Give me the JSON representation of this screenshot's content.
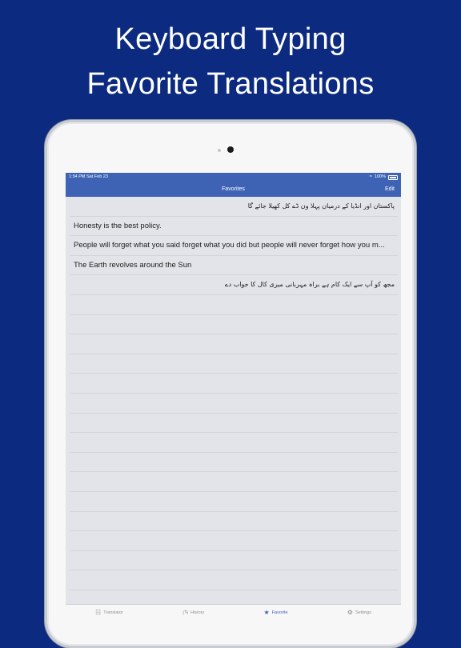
{
  "promo": {
    "line1": "Keyboard Typing",
    "line2": "Favorite Translations"
  },
  "status_bar": {
    "time": "1:54 PM",
    "date": "Sat Feb 23",
    "battery": "100%"
  },
  "nav": {
    "title": "Favorites",
    "edit_label": "Edit"
  },
  "favorites": [
    {
      "text": "پاکستان اور انڈیا کے درمیان پہلا ون ڈے کل کھیلا جائے گا",
      "lang": "ur"
    },
    {
      "text": "Honesty is the best policy.",
      "lang": "en"
    },
    {
      "text": "People will forget what you said forget what you did but people will never forget how you m...",
      "lang": "en"
    },
    {
      "text": "The Earth revolves around the Sun",
      "lang": "en"
    },
    {
      "text": "مجھ کو آپ سے ایک کام ہے براہ مہربانی میری کال کا جواب دے",
      "lang": "ur"
    }
  ],
  "empty_rows": 15,
  "tabs": [
    {
      "label": "Translator",
      "icon": "translate-icon",
      "active": false
    },
    {
      "label": "History",
      "icon": "clock-icon",
      "active": false
    },
    {
      "label": "Favorite",
      "icon": "star-icon",
      "active": true
    },
    {
      "label": "Settings",
      "icon": "gear-icon",
      "active": false
    }
  ],
  "colors": {
    "background": "#0c2b80",
    "nav_bar": "#3e63b4",
    "list_bg": "#e3e4e9"
  }
}
